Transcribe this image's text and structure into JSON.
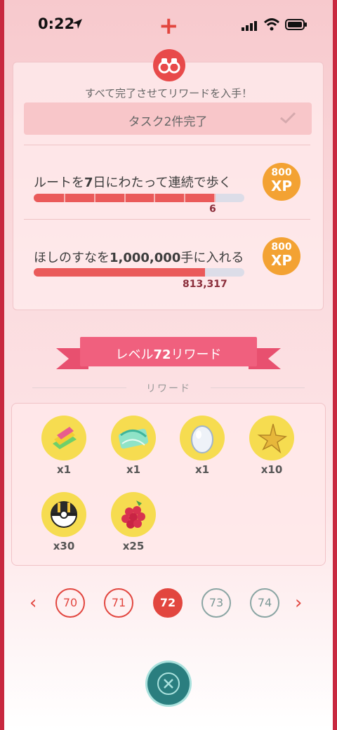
{
  "status": {
    "time": "0:22"
  },
  "tasks_card": {
    "subtitle": "すべて完了させてリワードを入手！",
    "completed_label": "タスク2件完了",
    "tasks": [
      {
        "title_pre": "ルートを",
        "title_bold": "7",
        "title_post": "日にわたって連続で歩く",
        "progress_value": "6",
        "progress_fraction": 0.857,
        "segments": 7,
        "xp_amount": "800",
        "xp_unit": "XP"
      },
      {
        "title_pre": "ほしのすなを",
        "title_bold": "1,000,000",
        "title_post": "手に入れる",
        "progress_value": "813,317",
        "progress_fraction": 0.813,
        "xp_amount": "800",
        "xp_unit": "XP"
      }
    ]
  },
  "banner": {
    "pre": "レベル",
    "bold": "72",
    "post": "リワード"
  },
  "rewards_label": "リワード",
  "rewards": [
    {
      "icon": "rare-candy-xl-icon",
      "qty": "x1"
    },
    {
      "icon": "elite-tm-icon",
      "qty": "x1"
    },
    {
      "icon": "egg-icon",
      "qty": "x1"
    },
    {
      "icon": "star-piece-icon",
      "qty": "x10"
    },
    {
      "icon": "ultra-ball-icon",
      "qty": "x30"
    },
    {
      "icon": "razz-berry-icon",
      "qty": "x25"
    }
  ],
  "levels": [
    "70",
    "71",
    "72",
    "73",
    "74"
  ],
  "colors": {
    "accent": "#e2463f",
    "xp_badge": "#f3a233",
    "reward_circle": "#f6dc50",
    "ribbon": "#f0607e",
    "close_button": "#2a7e7f"
  }
}
